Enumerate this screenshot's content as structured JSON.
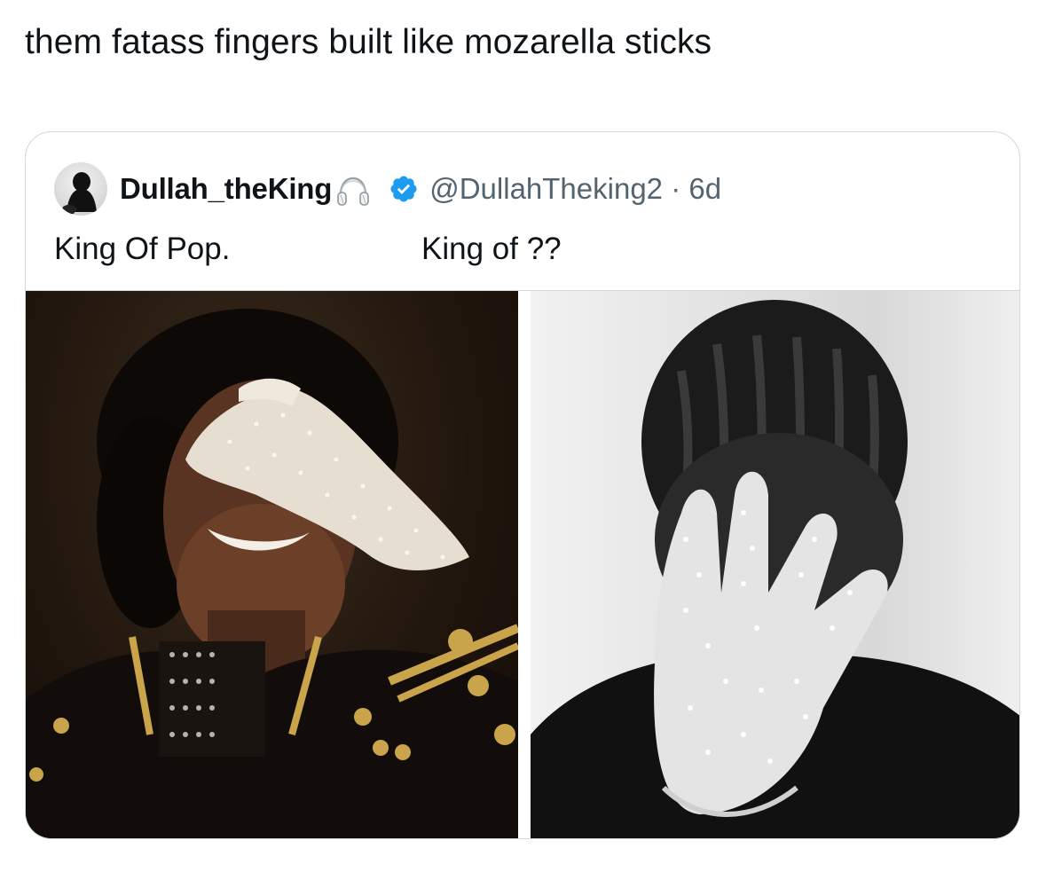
{
  "tweet": {
    "text": "them fatass fingers built like mozarella sticks"
  },
  "quoted_tweet": {
    "display_name": "Dullah_theKing",
    "handle_meta": "@DullahTheking2 · 6d",
    "verified": true,
    "name_badge_icon": "headphones-icon",
    "text_left": "King Of Pop.",
    "text_right": "King of ??",
    "media": [
      {
        "description_icon": "photo-left-sequined-glove"
      },
      {
        "description_icon": "photo-right-sequined-glove"
      }
    ]
  },
  "colors": {
    "text": "#0f1419",
    "secondary_text": "#536471",
    "border": "#cfd9de",
    "verified_blue": "#1d9bf0"
  }
}
